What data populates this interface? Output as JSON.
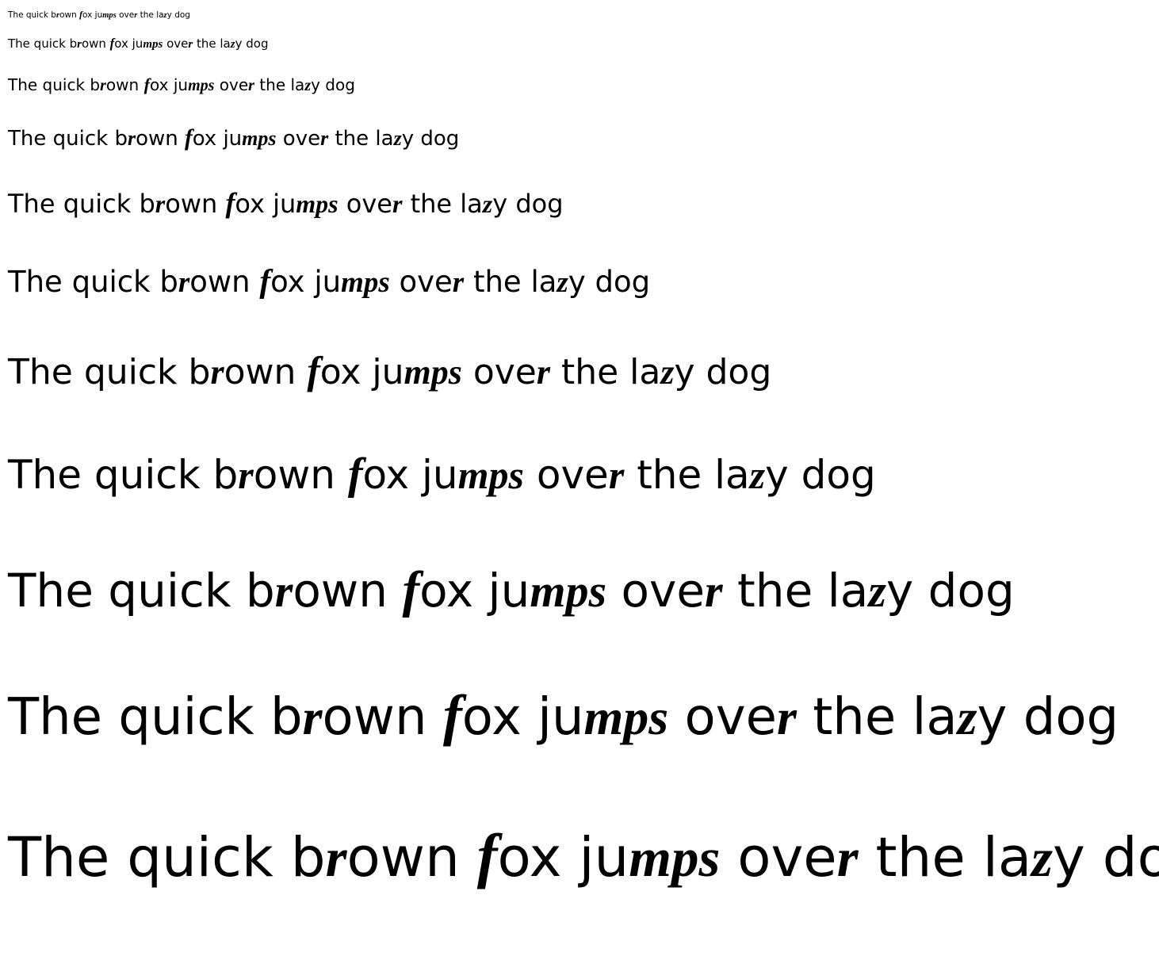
{
  "specimen_lines": [
    {
      "p1": "The quick b",
      "s1": "r",
      "p2": "own ",
      "s2": "f",
      "p3": "ox ju",
      "s3": "mps",
      "p4": " ove",
      "s4": "r",
      "p5": " the la",
      "s5": "z",
      "p6": "y dog"
    },
    {
      "p1": "The quick b",
      "s1": "r",
      "p2": "own ",
      "s2": "f",
      "p3": "ox ju",
      "s3": "mps",
      "p4": " ove",
      "s4": "r",
      "p5": " the la",
      "s5": "z",
      "p6": "y dog"
    },
    {
      "p1": "The quick b",
      "s1": "r",
      "p2": "own ",
      "s2": "f",
      "p3": "ox ju",
      "s3": "mps",
      "p4": " ove",
      "s4": "r",
      "p5": " the la",
      "s5": "z",
      "p6": "y dog"
    },
    {
      "p1": "The quick b",
      "s1": "r",
      "p2": "own ",
      "s2": "f",
      "p3": "ox ju",
      "s3": "mps",
      "p4": " ove",
      "s4": "r",
      "p5": " the la",
      "s5": "z",
      "p6": "y dog"
    },
    {
      "p1": "The quick b",
      "s1": "r",
      "p2": "own ",
      "s2": "f",
      "p3": "ox ju",
      "s3": "mps",
      "p4": " ove",
      "s4": "r",
      "p5": " the la",
      "s5": "z",
      "p6": "y dog"
    },
    {
      "p1": "The quick b",
      "s1": "r",
      "p2": "own ",
      "s2": "f",
      "p3": "ox ju",
      "s3": "mps",
      "p4": " ove",
      "s4": "r",
      "p5": " the la",
      "s5": "z",
      "p6": "y dog"
    },
    {
      "p1": "The quick b",
      "s1": "r",
      "p2": "own ",
      "s2": "f",
      "p3": "ox ju",
      "s3": "mps",
      "p4": " ove",
      "s4": "r",
      "p5": " the la",
      "s5": "z",
      "p6": "y dog"
    },
    {
      "p1": "The quick b",
      "s1": "r",
      "p2": "own ",
      "s2": "f",
      "p3": "ox ju",
      "s3": "mps",
      "p4": " ove",
      "s4": "r",
      "p5": " the la",
      "s5": "z",
      "p6": "y dog"
    },
    {
      "p1": "The quick b",
      "s1": "r",
      "p2": "own ",
      "s2": "f",
      "p3": "ox ju",
      "s3": "mps",
      "p4": " ove",
      "s4": "r",
      "p5": " the la",
      "s5": "z",
      "p6": "y dog"
    },
    {
      "p1": "The quick b",
      "s1": "r",
      "p2": "own ",
      "s2": "f",
      "p3": "ox ju",
      "s3": "mps",
      "p4": " ove",
      "s4": "r",
      "p5": " the la",
      "s5": "z",
      "p6": "y dog"
    },
    {
      "p1": "The quick b",
      "s1": "r",
      "p2": "own ",
      "s2": "f",
      "p3": "ox ju",
      "s3": "mps",
      "p4": " ove",
      "s4": "r",
      "p5": " the la",
      "s5": "z",
      "p6": "y dog"
    }
  ],
  "colors": {
    "background": "#ffffff",
    "text": "#000000"
  }
}
